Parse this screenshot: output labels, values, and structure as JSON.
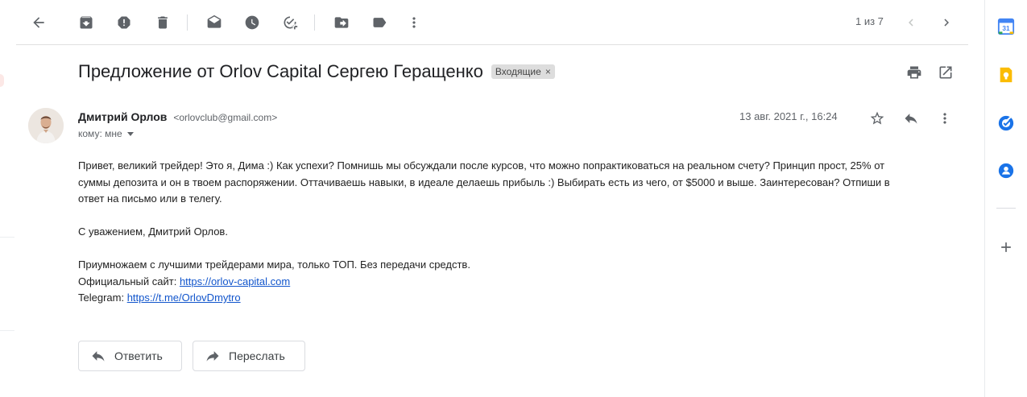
{
  "toolbar": {
    "icons": [
      "back-arrow-icon",
      "archive-icon",
      "report-spam-icon",
      "delete-icon",
      "mark-unread-icon",
      "snooze-icon",
      "add-task-icon",
      "move-to-icon",
      "label-icon",
      "more-vert-icon",
      "chevron-left-icon",
      "chevron-right-icon"
    ],
    "pager": "1 из 7"
  },
  "email": {
    "subject": "Предложение от Orlov Capital Сергею Геращенко",
    "label": "Входящие",
    "label_remove": "×",
    "sender_name": "Дмитрий Орлов",
    "sender_email": "<orlovclub@gmail.com>",
    "to": "кому: мне",
    "date": "13 авг. 2021 г., 16:24",
    "body": {
      "paragraph1_line1": "Привет, великий трейдер! Это я, Дима :) Как успехи? Помнишь мы обсуждали после курсов, что можно попрактиковаться на реальном счету? Принцип прост, 25% от",
      "paragraph1_line2": "суммы депозита и он в твоем распоряжении. Оттачиваешь навыки, в идеале делаешь прибыль :) Выбирать есть из чего, от $5000 и выше. Заинтересован? Отпиши в",
      "paragraph1_line3": "ответ на письмо или в телегу.",
      "signature": "С уважением, Дмитрий Орлов.",
      "promo": "Приумножаем с лучшими трейдерами мира, только ТОП. Без передачи средств.",
      "site_label": "Официальный сайт: ",
      "site_link": "https://orlov-capital.com",
      "telegram_label": "Telegram: ",
      "telegram_link": "https://t.me/OrlovDmytro"
    }
  },
  "actions": {
    "reply": "Ответить",
    "forward": "Переслать"
  },
  "side_panel": {
    "icons": [
      "calendar-icon",
      "keep-icon",
      "tasks-icon",
      "contacts-icon",
      "add-icon"
    ],
    "calendar_day": "31",
    "colors": {
      "calendar": "#4285f4",
      "keep": "#fbbc04",
      "tasks": "#1a73e8",
      "contacts": "#1a73e8"
    }
  }
}
